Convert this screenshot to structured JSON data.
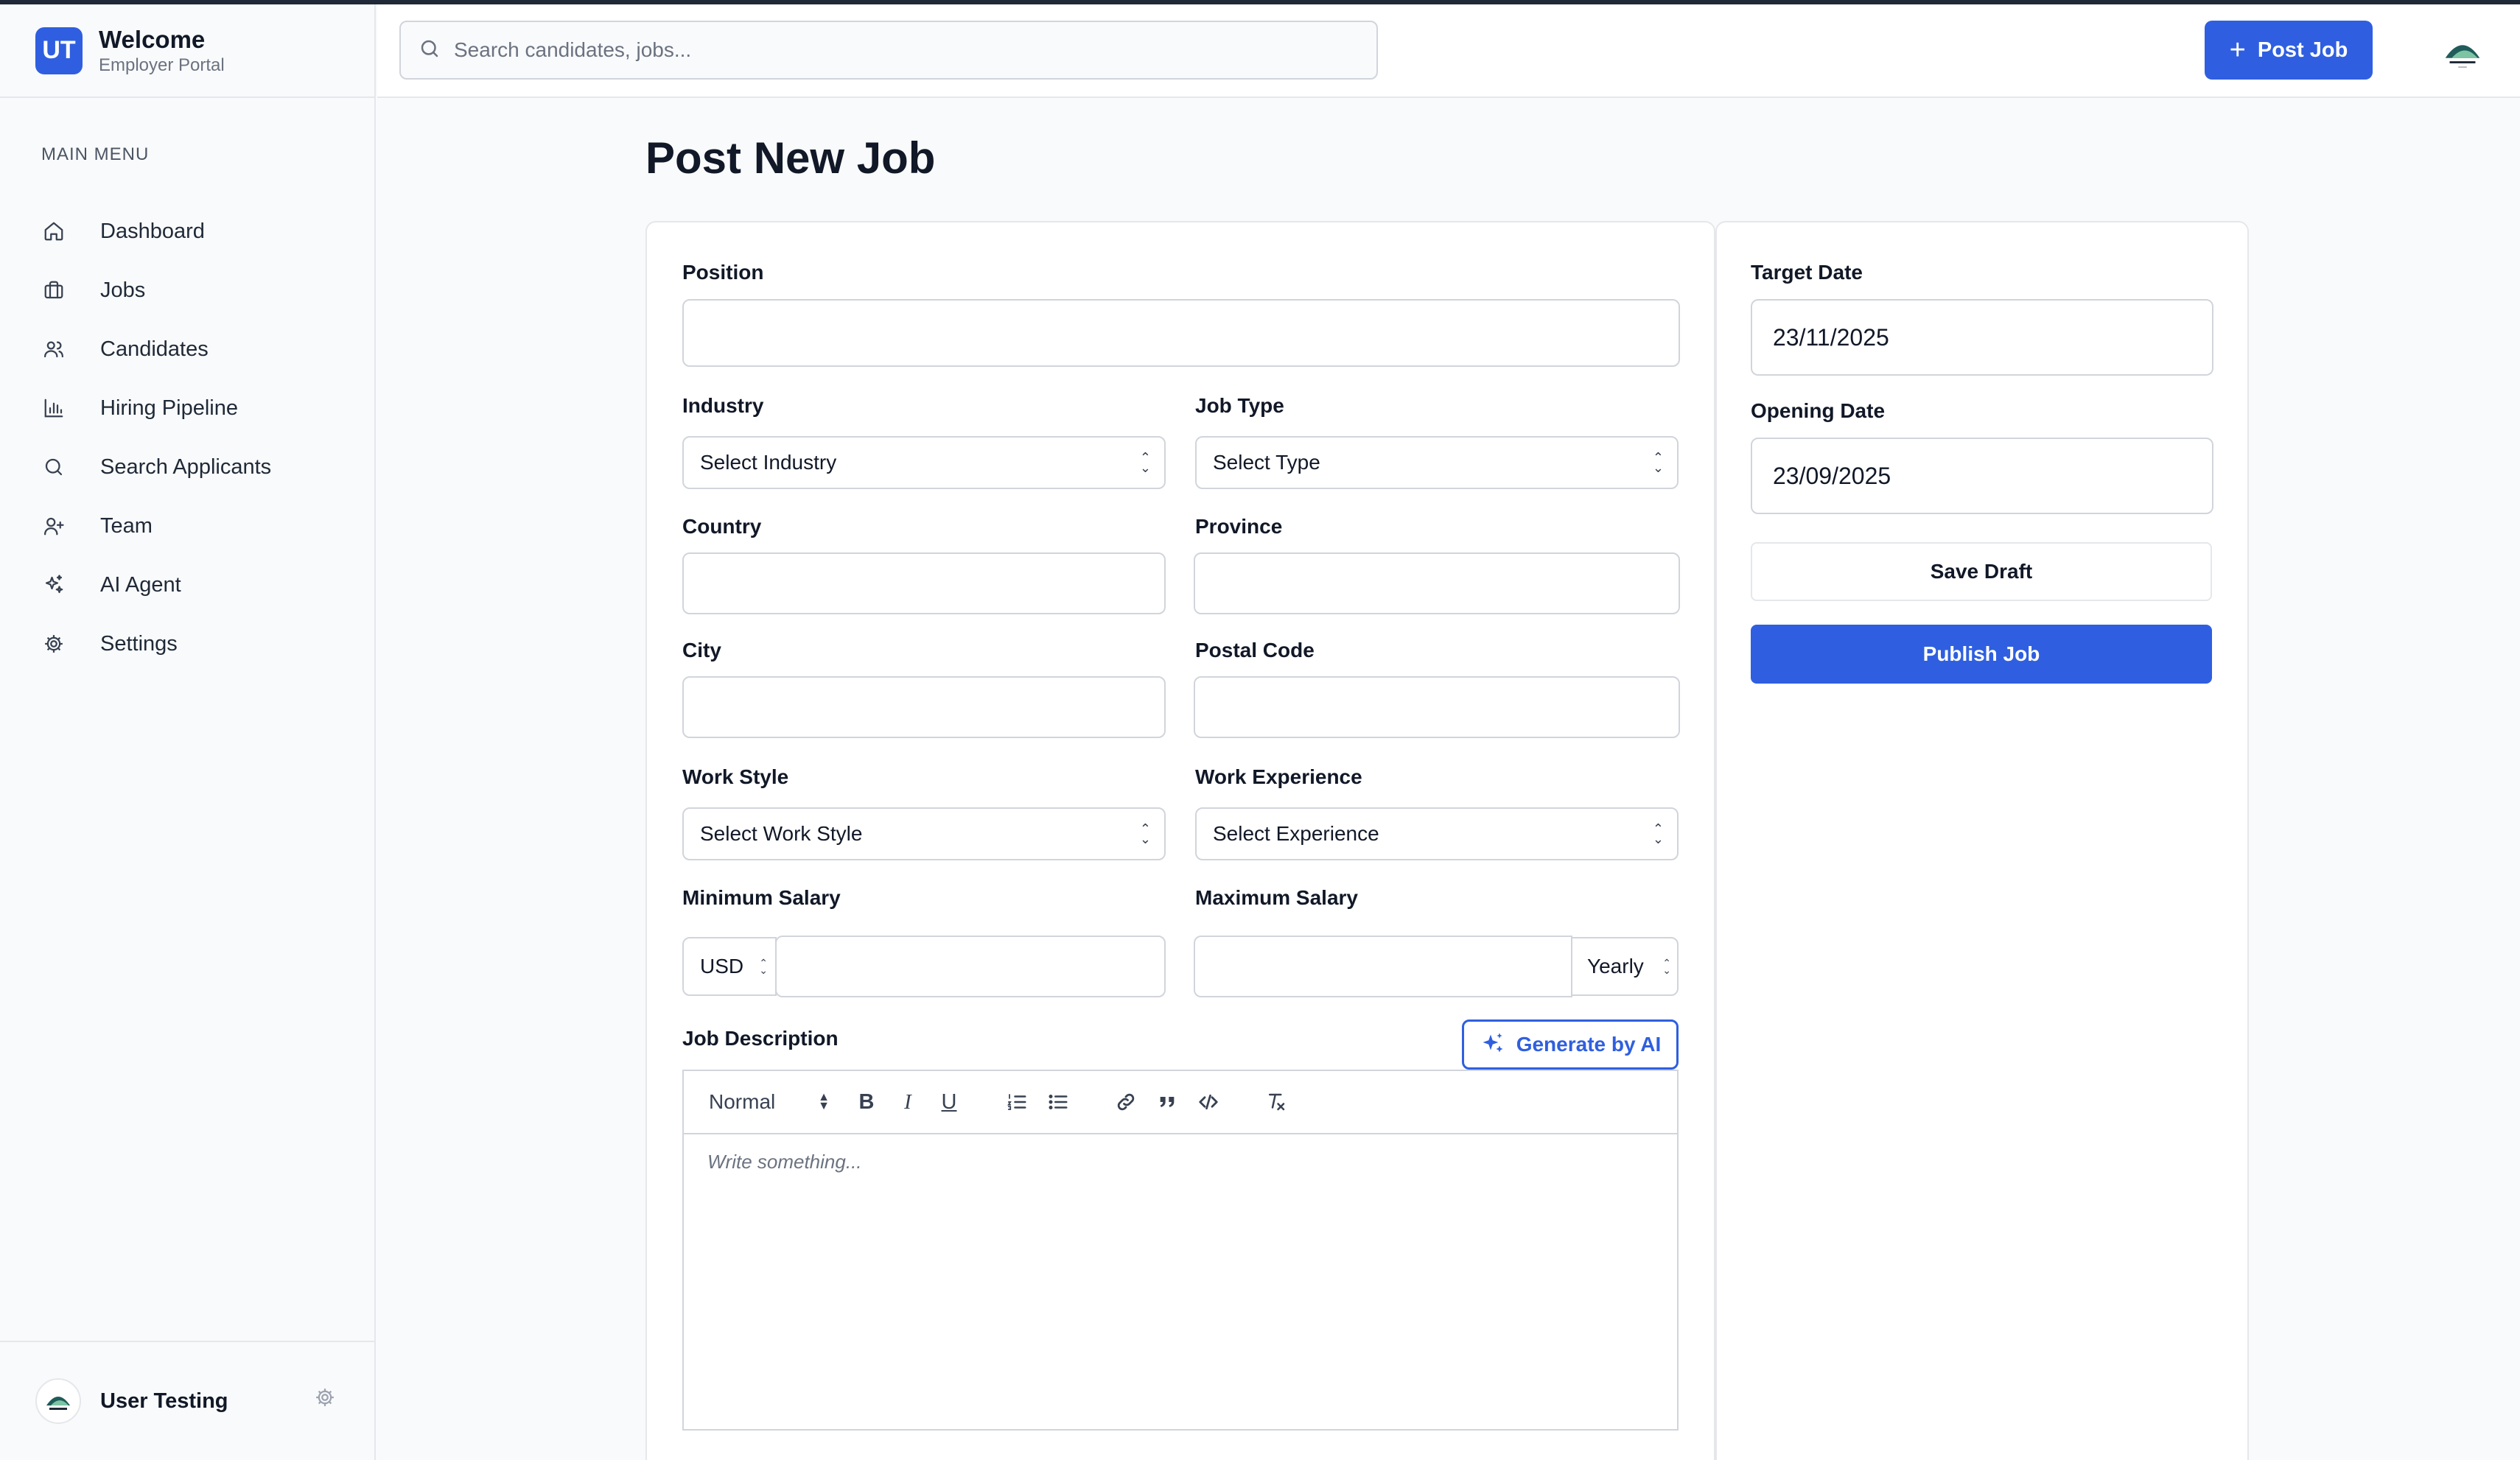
{
  "brand": {
    "badge": "UT",
    "title": "Welcome",
    "subtitle": "Employer Portal"
  },
  "search": {
    "placeholder": "Search candidates, jobs...",
    "icon": "search-icon"
  },
  "header": {
    "post_job_label": "Post Job"
  },
  "sidebar": {
    "heading": "MAIN MENU",
    "items": [
      {
        "label": "Dashboard",
        "icon": "home-icon"
      },
      {
        "label": "Jobs",
        "icon": "briefcase-icon"
      },
      {
        "label": "Candidates",
        "icon": "users-icon"
      },
      {
        "label": "Hiring Pipeline",
        "icon": "bar-chart-icon"
      },
      {
        "label": "Search Applicants",
        "icon": "search-icon"
      },
      {
        "label": "Team",
        "icon": "user-plus-icon"
      },
      {
        "label": "AI Agent",
        "icon": "sparkles-icon"
      },
      {
        "label": "Settings",
        "icon": "gear-icon"
      }
    ],
    "footer_user": "User Testing"
  },
  "page": {
    "title": "Post New Job"
  },
  "form": {
    "position_label": "Position",
    "industry_label": "Industry",
    "industry_value": "Select Industry",
    "job_type_label": "Job Type",
    "job_type_value": "Select Type",
    "country_label": "Country",
    "province_label": "Province",
    "city_label": "City",
    "postal_code_label": "Postal Code",
    "work_style_label": "Work Style",
    "work_style_value": "Select Work Style",
    "work_experience_label": "Work Experience",
    "work_experience_value": "Select Experience",
    "min_salary_label": "Minimum Salary",
    "currency_value": "USD",
    "max_salary_label": "Maximum Salary",
    "period_value": "Yearly",
    "description_label": "Job Description",
    "generate_label": "Generate by AI",
    "editor_format": "Normal",
    "editor_placeholder": "Write something...",
    "toolbar_bold": "B",
    "toolbar_italic": "I",
    "toolbar_underline": "U"
  },
  "side": {
    "target_date_label": "Target Date",
    "target_date_value": "23/11/2025",
    "opening_date_label": "Opening Date",
    "opening_date_value": "23/09/2025",
    "save_draft_label": "Save Draft",
    "publish_label": "Publish Job"
  },
  "colors": {
    "accent": "#2f5fe0",
    "border": "#d1d5db",
    "background": "#f9fafb"
  }
}
